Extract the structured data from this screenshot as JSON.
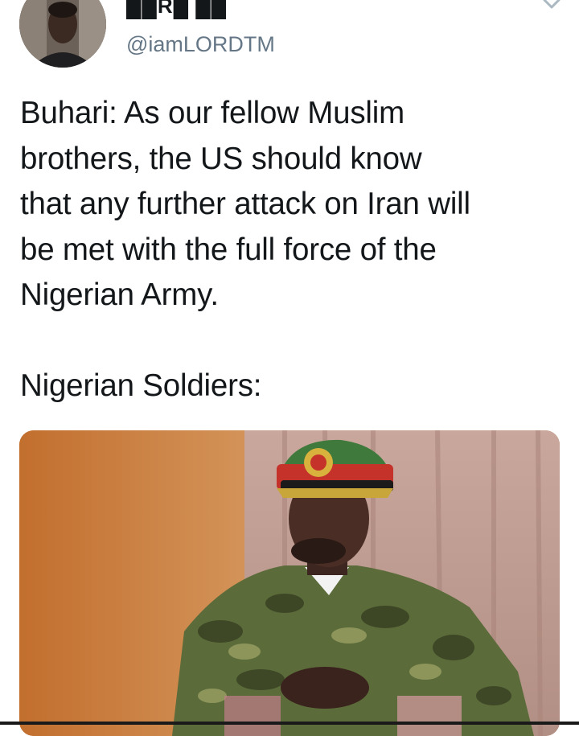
{
  "tweet": {
    "author": {
      "display_name": "██R█ ██",
      "handle": "@iamLORDTM"
    },
    "text_lines": [
      "Buhari: As our fellow Muslim",
      "brothers, the US should know",
      "that any further attack on Iran will",
      "be met with the full force of the",
      "Nigerian Army.",
      "",
      "Nigerian Soldiers:"
    ],
    "media": {
      "kind": "photo",
      "subject": "man-in-military-uniform"
    },
    "icons": {
      "menu": "chevron-down-icon",
      "avatar": "profile-photo"
    }
  },
  "colors": {
    "text": "#14171a",
    "handle": "#657786",
    "background": "#ffffff"
  }
}
